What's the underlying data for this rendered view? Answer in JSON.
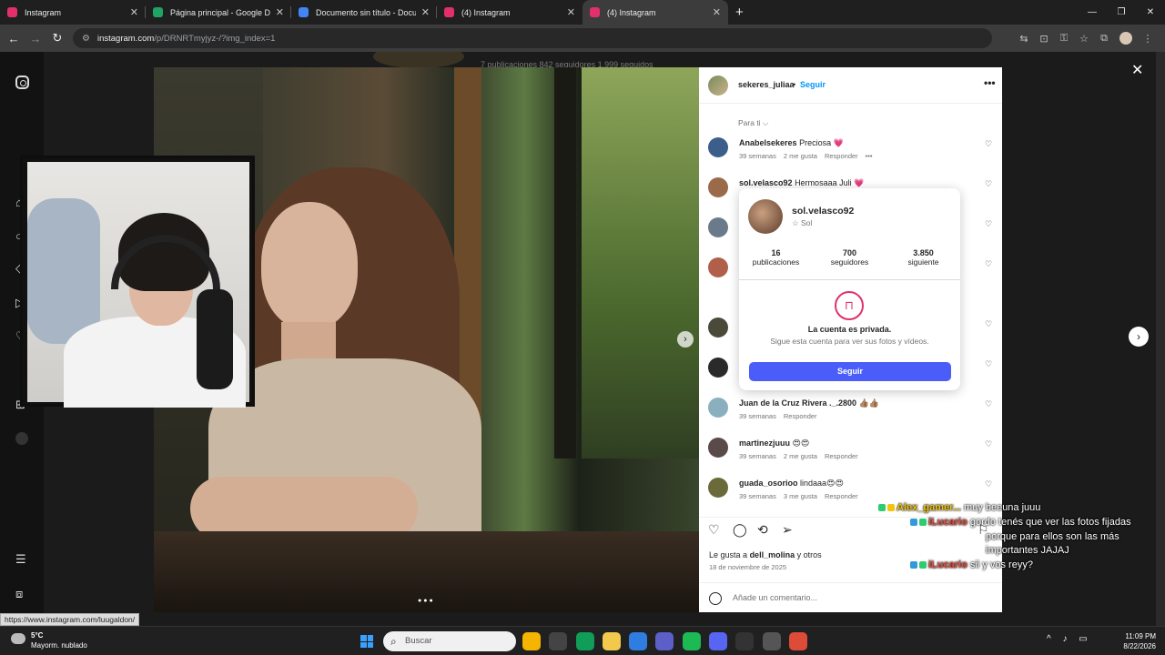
{
  "browser": {
    "tabs": [
      {
        "title": "Instagram",
        "color": "#e1306c"
      },
      {
        "title": "Página principal - Google Drive",
        "color": "#1fa463"
      },
      {
        "title": "Documento sin título - Docum",
        "color": "#4285f4"
      },
      {
        "title": "(4) Instagram",
        "color": "#e1306c"
      },
      {
        "title": "(4) Instagram",
        "color": "#e1306c"
      }
    ],
    "url_host": "instagram.com",
    "url_path": "/p/DRNRTmyjyz-/?img_index=1",
    "status_url": "https://www.instagram.com/luugaldon/"
  },
  "profile_bg": {
    "stats_text": "7 publicaciones   842 seguidores   1.999 seguidos"
  },
  "post": {
    "username": "sekeres_juliaa",
    "dot": "•",
    "follow_label": "Seguir",
    "more_label": "•••",
    "filter_label": "Para ti ⌵",
    "comments": [
      {
        "user": "Anabelsekeres",
        "text": "Preciosa 💗",
        "time": "39 semanas",
        "likes": "2 me gusta",
        "reply": "Responder",
        "extra": "•••",
        "avatar_color": "#3b5f8a"
      },
      {
        "user": "sol.velasco92",
        "text": "Hermosaaa Juli 💗",
        "time": "",
        "likes": "",
        "reply": "",
        "extra": "",
        "avatar_color": "#9a6a4a"
      },
      {
        "user": "",
        "text": "",
        "time": "",
        "likes": "",
        "reply": "",
        "extra": "",
        "avatar_color": "#6b7a8a"
      },
      {
        "user": "",
        "text": "",
        "time": "",
        "likes": "",
        "reply": "",
        "extra": "",
        "avatar_color": "#b0604a"
      },
      {
        "user": "",
        "text": "",
        "time": "",
        "likes": "",
        "reply": "",
        "extra": "",
        "avatar_color": "#4a4a3a"
      },
      {
        "user": "",
        "text": "",
        "time": "",
        "likes": "",
        "reply": "",
        "extra": "",
        "avatar_color": "#2a2a2a"
      },
      {
        "user": "Juan de la Cruz Rivera ._.2800",
        "text": "👍🏽👍🏽",
        "time": "39 semanas",
        "likes": "",
        "reply": "Responder",
        "extra": "",
        "avatar_color": "#8ab0c0"
      },
      {
        "user": "martinezjuuu",
        "text": "😍😍",
        "time": "39 semanas",
        "likes": "2 me gusta",
        "reply": "Responder",
        "extra": "",
        "avatar_color": "#5a4a4a"
      },
      {
        "user": "guada_osorioo",
        "text": "lindaaa😍😍",
        "time": "39 semanas",
        "likes": "3 me gusta",
        "reply": "Responder",
        "extra": "",
        "avatar_color": "#6a6a3a"
      }
    ],
    "likes_prefix": "Le gusta a",
    "likes_user": "dell_molina",
    "likes_suffix": "y otros",
    "date": "18 de noviembre de 2025",
    "add_comment_placeholder": "Añade un comentario..."
  },
  "hover_card": {
    "username": "sol.velasco92",
    "name": "☆ Sol",
    "stats": [
      {
        "n": "16",
        "label": "publicaciones"
      },
      {
        "n": "700",
        "label": "seguidores"
      },
      {
        "n": "3.850",
        "label": "siguiente"
      }
    ],
    "lock_icon": "🔒",
    "private_title": "La cuenta es privada.",
    "private_sub": "Sigue esta cuenta para ver sus fotos y vídeos.",
    "follow_label": "Seguir"
  },
  "chat": [
    {
      "name": "Alex_gamer...",
      "text": "muy beeuna juuu",
      "badge_colors": [
        "#2ecc71",
        "#f1c40f"
      ],
      "name_color": "#f1c40f"
    },
    {
      "name": "iLucario",
      "text": "gordo tenés que ver las fotos fijadas",
      "badge_colors": [
        "#3498db",
        "#2ecc71"
      ],
      "name_color": "#e74c3c"
    },
    {
      "name": "",
      "text": "porque para ellos son las más",
      "badge_colors": [],
      "name_color": "#ffffff"
    },
    {
      "name": "",
      "text": "importantes JAJAJ",
      "badge_colors": [],
      "name_color": "#ffffff"
    },
    {
      "name": "iLucario",
      "text": "sii y vos reyy?",
      "badge_colors": [
        "#3498db",
        "#2ecc71"
      ],
      "name_color": "#e74c3c"
    }
  ],
  "taskbar": {
    "temp": "5°C",
    "weather": "Mayorm. nublado",
    "search_placeholder": "Buscar",
    "time": "11:09 PM",
    "date": "8/22/2026",
    "app_colors": [
      "#f4b400",
      "#444444",
      "#0f9d58",
      "#f2c94c",
      "#2f7de1",
      "#5b5fc7",
      "#1db954",
      "#5865f2",
      "#333333",
      "#555555",
      "#dd4b39"
    ]
  }
}
